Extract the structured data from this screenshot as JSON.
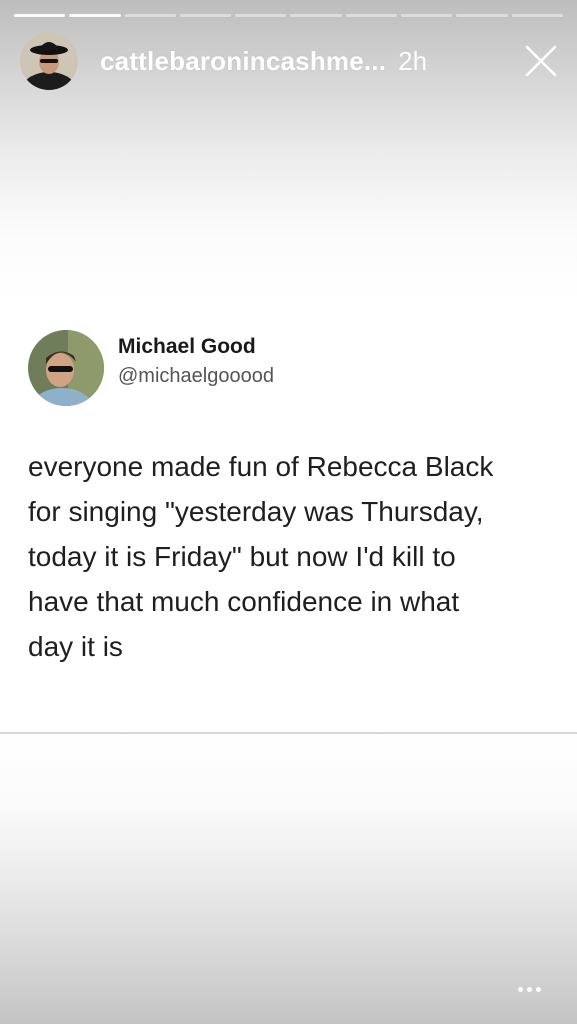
{
  "story": {
    "progress": {
      "total_segments": 10,
      "completed_segments": 2
    },
    "username": "cattlebaronincashme...",
    "time_ago": "2h"
  },
  "tweet": {
    "author_name": "Michael Good",
    "author_handle": "@michaelgooood",
    "text_lines": [
      "everyone made fun of Rebecca Black",
      "for singing \"yesterday was Thursday,",
      "today it is Friday\" but now I'd kill to",
      "have that much confidence in what",
      "day it is"
    ]
  },
  "icons": {
    "close": "close-icon",
    "more": "more-options-icon",
    "story_avatar": "avatar",
    "tweet_avatar": "avatar"
  }
}
